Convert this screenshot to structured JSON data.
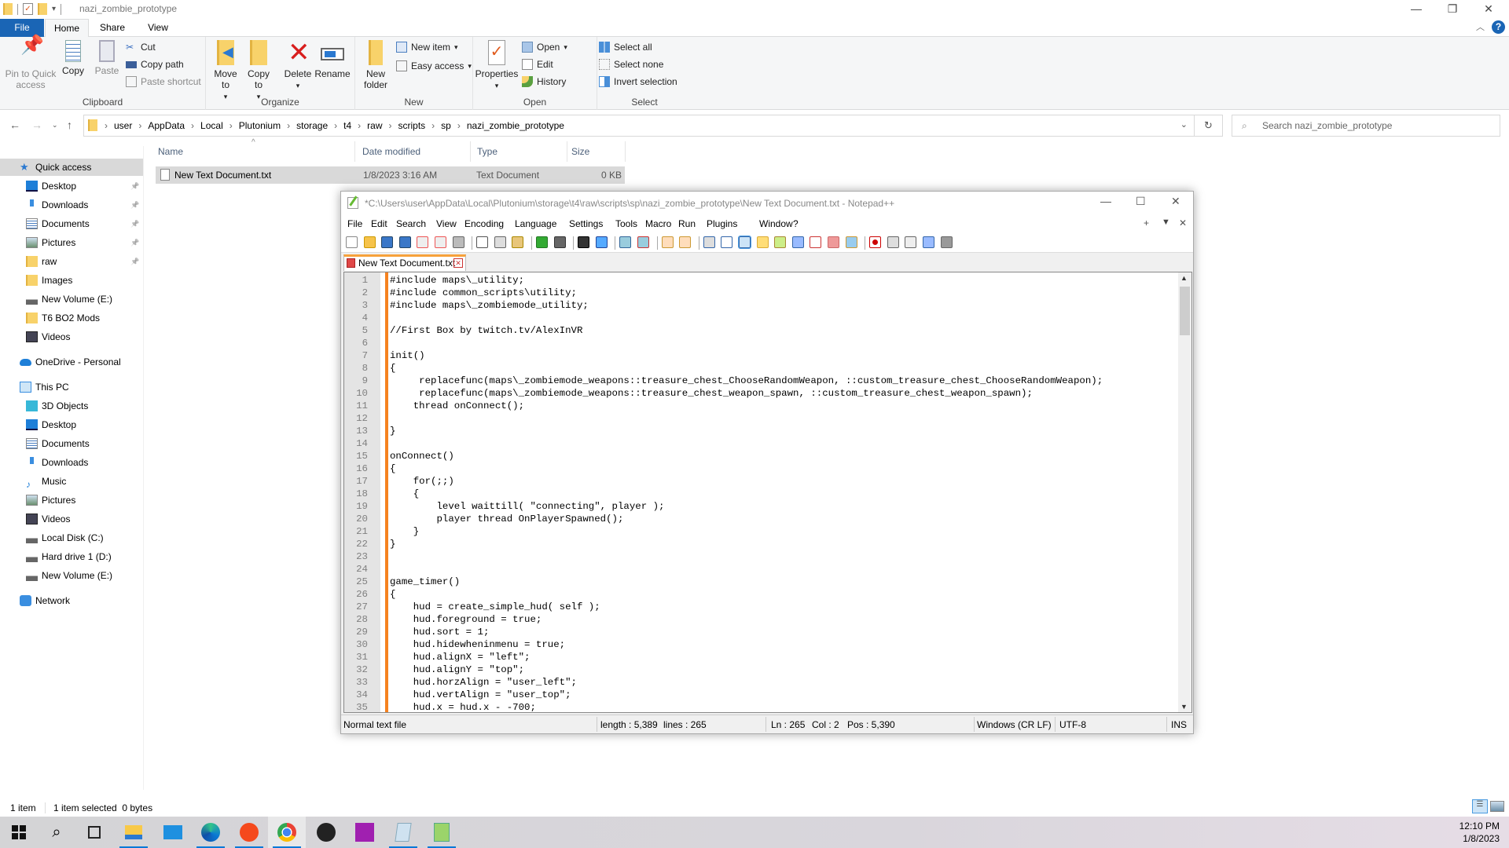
{
  "explorer": {
    "window_title": "nazi_zombie_prototype",
    "window_controls": {
      "minimize": "—",
      "restore": "❐",
      "close": "✕"
    },
    "ribbon_tabs": [
      "File",
      "Home",
      "Share",
      "View"
    ],
    "ribbon": {
      "clipboard": {
        "label": "Clipboard",
        "pin": "Pin to Quick access",
        "copy": "Copy",
        "paste": "Paste",
        "cut": "Cut",
        "copy_path": "Copy path",
        "paste_shortcut": "Paste shortcut"
      },
      "organize": {
        "label": "Organize",
        "move_to": "Move to",
        "copy_to": "Copy to",
        "delete": "Delete",
        "rename": "Rename"
      },
      "new": {
        "label": "New",
        "new_folder": "New folder",
        "new_item": "New item",
        "easy_access": "Easy access"
      },
      "open": {
        "label": "Open",
        "properties": "Properties",
        "open": "Open",
        "edit": "Edit",
        "history": "History"
      },
      "select": {
        "label": "Select",
        "select_all": "Select all",
        "select_none": "Select none",
        "invert": "Invert selection"
      }
    },
    "breadcrumb": [
      "user",
      "AppData",
      "Local",
      "Plutonium",
      "storage",
      "t4",
      "raw",
      "scripts",
      "sp",
      "nazi_zombie_prototype"
    ],
    "search_placeholder": "Search nazi_zombie_prototype",
    "sidebar": {
      "quick_access": "Quick access",
      "quick_items": [
        {
          "label": "Desktop",
          "pinned": true,
          "icon": "desktop-icon"
        },
        {
          "label": "Downloads",
          "pinned": true,
          "icon": "downloads-icon"
        },
        {
          "label": "Documents",
          "pinned": true,
          "icon": "documents-icon"
        },
        {
          "label": "Pictures",
          "pinned": true,
          "icon": "pictures-icon"
        },
        {
          "label": "raw",
          "pinned": true,
          "icon": "folder-icon"
        },
        {
          "label": "Images",
          "pinned": false,
          "icon": "folder-icon"
        },
        {
          "label": "New Volume (E:)",
          "pinned": false,
          "icon": "drive-icon"
        },
        {
          "label": "T6 BO2 Mods",
          "pinned": false,
          "icon": "folder-icon"
        },
        {
          "label": "Videos",
          "pinned": false,
          "icon": "videos-icon"
        }
      ],
      "onedrive": "OneDrive - Personal",
      "this_pc": "This PC",
      "pc_items": [
        {
          "label": "3D Objects",
          "icon": "3d-objects-icon"
        },
        {
          "label": "Desktop",
          "icon": "desktop-icon"
        },
        {
          "label": "Documents",
          "icon": "documents-icon"
        },
        {
          "label": "Downloads",
          "icon": "downloads-icon"
        },
        {
          "label": "Music",
          "icon": "music-icon"
        },
        {
          "label": "Pictures",
          "icon": "pictures-icon"
        },
        {
          "label": "Videos",
          "icon": "videos-icon"
        },
        {
          "label": "Local Disk (C:)",
          "icon": "drive-icon"
        },
        {
          "label": "Hard drive 1 (D:)",
          "icon": "drive-icon"
        },
        {
          "label": "New Volume (E:)",
          "icon": "drive-icon"
        }
      ],
      "network": "Network"
    },
    "columns": [
      "Name",
      "Date modified",
      "Type",
      "Size"
    ],
    "files": [
      {
        "name": "New Text Document.txt",
        "date": "1/8/2023 3:16 AM",
        "type": "Text Document",
        "size": "0 KB"
      }
    ],
    "status": {
      "count": "1 item",
      "selected": "1 item selected  0 bytes"
    }
  },
  "notepadpp": {
    "title": "*C:\\Users\\user\\AppData\\Local\\Plutonium\\storage\\t4\\raw\\scripts\\sp\\nazi_zombie_prototype\\New Text Document.txt - Notepad++",
    "menu": [
      "File",
      "Edit",
      "Search",
      "View",
      "Encoding",
      "Language",
      "Settings",
      "Tools",
      "Macro",
      "Run",
      "Plugins",
      "Window",
      "?"
    ],
    "tab": "New Text Document.txt",
    "lines": [
      "#include maps\\_utility;",
      "#include common_scripts\\utility;",
      "#include maps\\_zombiemode_utility;",
      "",
      "//First Box by twitch.tv/AlexInVR",
      "",
      "init()",
      "{",
      "     replacefunc(maps\\_zombiemode_weapons::treasure_chest_ChooseRandomWeapon, ::custom_treasure_chest_ChooseRandomWeapon);",
      "     replacefunc(maps\\_zombiemode_weapons::treasure_chest_weapon_spawn, ::custom_treasure_chest_weapon_spawn);",
      "    thread onConnect();",
      "",
      "}",
      "",
      "onConnect()",
      "{",
      "    for(;;)",
      "    {",
      "        level waittill( \"connecting\", player );",
      "        player thread OnPlayerSpawned();",
      "    }",
      "}",
      "",
      "",
      "game_timer()",
      "{",
      "    hud = create_simple_hud( self );",
      "    hud.foreground = true;",
      "    hud.sort = 1;",
      "    hud.hidewheninmenu = true;",
      "    hud.alignX = \"left\";",
      "    hud.alignY = \"top\";",
      "    hud.horzAlign = \"user_left\";",
      "    hud.vertAlign = \"user_top\";",
      "    hud.x = hud.x - -700;"
    ],
    "status": {
      "file_type": "Normal text file",
      "length": "length : 5,389",
      "lines": "lines : 265",
      "ln": "Ln : 265",
      "col": "Col : 2",
      "pos": "Pos : 5,390",
      "eol": "Windows (CR LF)",
      "encoding": "UTF-8",
      "mode": "INS"
    }
  },
  "taskbar": {
    "apps": [
      "start",
      "search",
      "task-view",
      "file-explorer",
      "mail",
      "edge",
      "soundcloud",
      "chrome",
      "obs",
      "photos",
      "notepad",
      "notepadpp"
    ],
    "time": "12:10 PM",
    "date": "1/8/2023"
  }
}
